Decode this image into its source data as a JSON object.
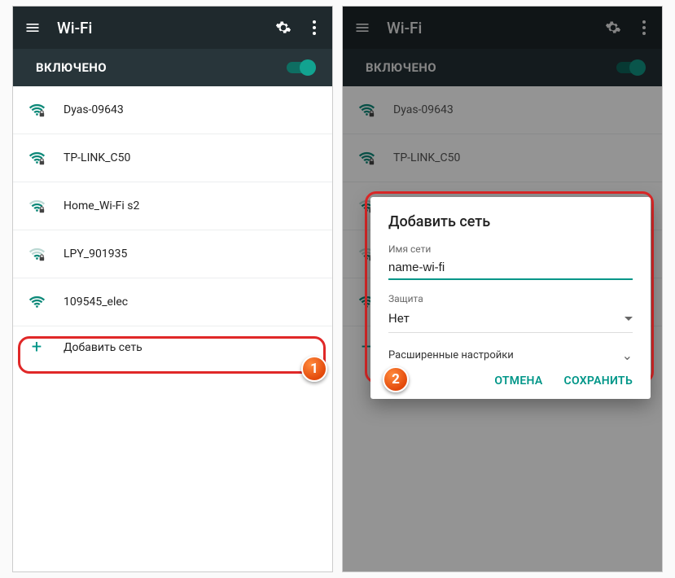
{
  "appbar": {
    "title": "Wi-Fi"
  },
  "subbar": {
    "enabled_label": "ВКЛЮЧЕНО"
  },
  "networks": [
    {
      "ssid": "Dyas-09643",
      "secured": true,
      "strength": 4
    },
    {
      "ssid": "TP-LINK_C50",
      "secured": true,
      "strength": 4
    },
    {
      "ssid": "Home_Wi-Fi s2",
      "secured": true,
      "strength": 3
    },
    {
      "ssid": "LPY_901935",
      "secured": true,
      "strength": 2
    },
    {
      "ssid": "109545_elec",
      "secured": false,
      "strength": 4
    }
  ],
  "add_network_label": "Добавить сеть",
  "dialog": {
    "title": "Добавить сеть",
    "ssid_label": "Имя сети",
    "ssid_value": "name-wi-fi",
    "security_label": "Защита",
    "security_value": "Нет",
    "advanced_label": "Расширенные настройки",
    "cancel": "ОТМЕНА",
    "save": "СОХРАНИТЬ"
  },
  "annotations": {
    "step1": "1",
    "step2": "2"
  },
  "colors": {
    "accent": "#009688",
    "highlight": "#e02828"
  }
}
